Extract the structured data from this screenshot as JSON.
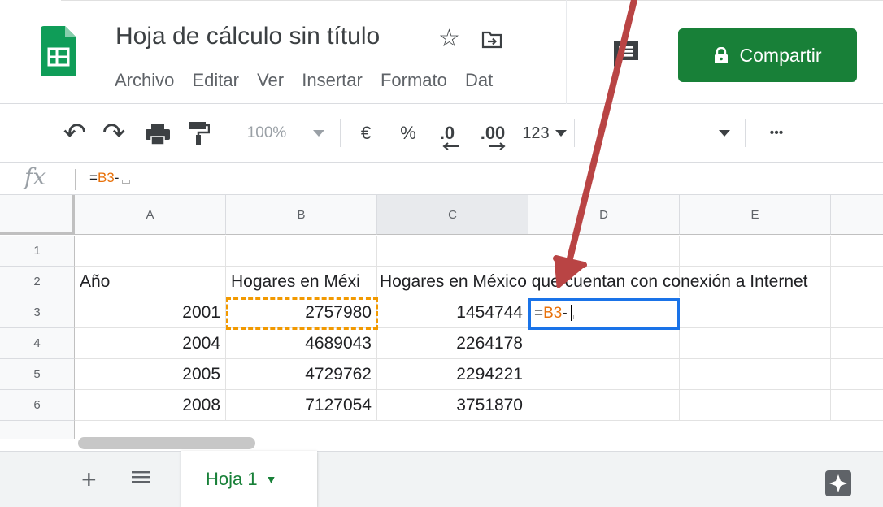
{
  "app": {
    "title": "Hoja de cálculo sin título",
    "star_glyph": "☆",
    "menu": [
      "Archivo",
      "Editar",
      "Ver",
      "Insertar",
      "Formato",
      "Dat"
    ],
    "share_label": "Compartir",
    "brand_color": "#188038"
  },
  "toolbar": {
    "undo": "↶",
    "redo": "↷",
    "zoom": "100%",
    "currency": "€",
    "percent": "%",
    "dec_less": ".0",
    "dec_more": ".00",
    "format_more": "123",
    "more": "•••"
  },
  "formula": {
    "fx": "fx",
    "prefix": "=",
    "ref": "B3",
    "suffix": "-"
  },
  "grid": {
    "columns": [
      "A",
      "B",
      "C",
      "D",
      "E"
    ],
    "rows": [
      "1",
      "2",
      "3",
      "4",
      "5",
      "6"
    ],
    "cells": {
      "A2": "Año",
      "B2": "Hogares en Méxi",
      "C2": "Hogares en México que cuentan con conexión a Internet",
      "A3": "2001",
      "B3": "2757980",
      "C3": "1454744",
      "A4": "2004",
      "B4": "4689043",
      "C4": "2264178",
      "A5": "2005",
      "B5": "4729762",
      "C5": "2294221",
      "A6": "2008",
      "B6": "7127054",
      "C6": "3751870"
    },
    "active_cell": {
      "prefix": "=",
      "ref": "B3",
      "suffix": "-"
    }
  },
  "sheets": {
    "add": "+",
    "tab_label": "Hoja 1",
    "tab_caret": "▼"
  },
  "colors": {
    "reference": "#f29900",
    "selection": "#1a73e8",
    "arrow": "#b94444"
  }
}
